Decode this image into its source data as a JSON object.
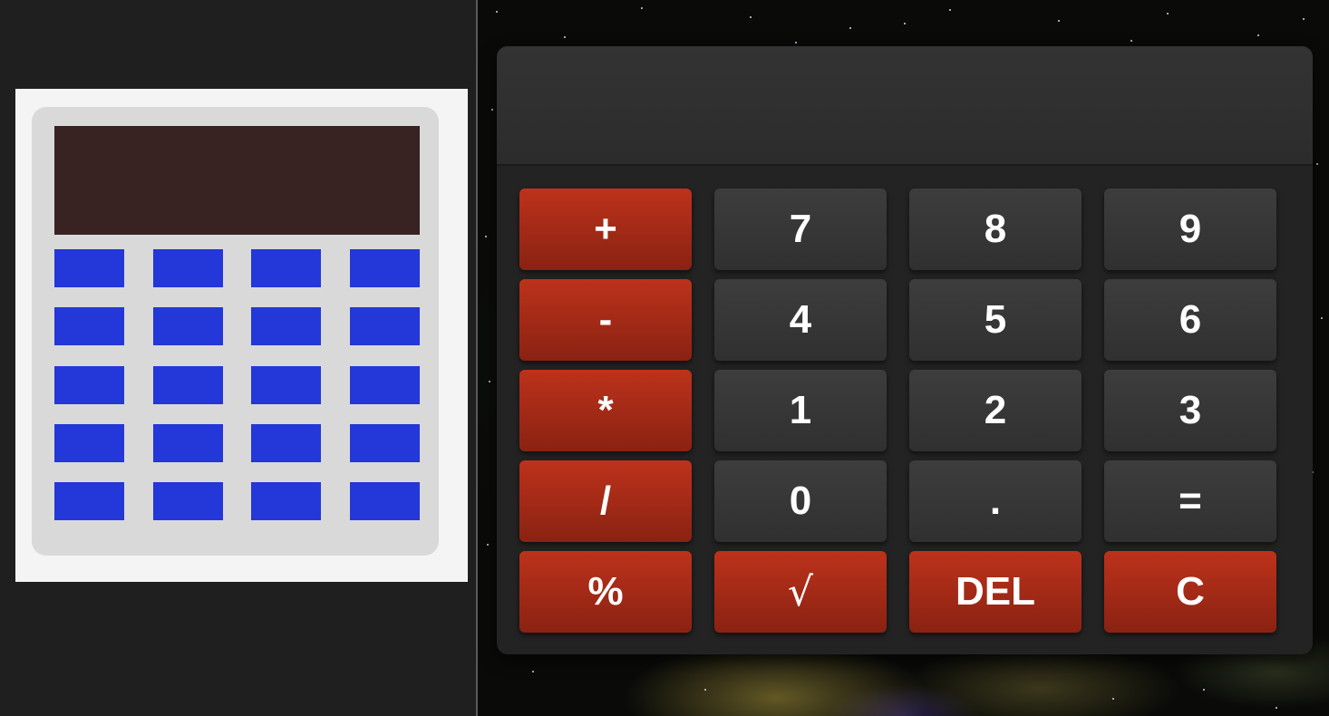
{
  "display": {
    "value": ""
  },
  "keypad": {
    "rows": [
      [
        "+",
        "7",
        "8",
        "9"
      ],
      [
        "-",
        "4",
        "5",
        "6"
      ],
      [
        "*",
        "1",
        "2",
        "3"
      ],
      [
        "/",
        "0",
        ".",
        "="
      ],
      [
        "%",
        "√",
        "DEL",
        "C"
      ]
    ]
  },
  "colors": {
    "operator_key": "#bd321b",
    "number_key": "#3d3d3d",
    "display": "#333333",
    "icon_screen": "#382322",
    "icon_key": "#2437d8"
  }
}
